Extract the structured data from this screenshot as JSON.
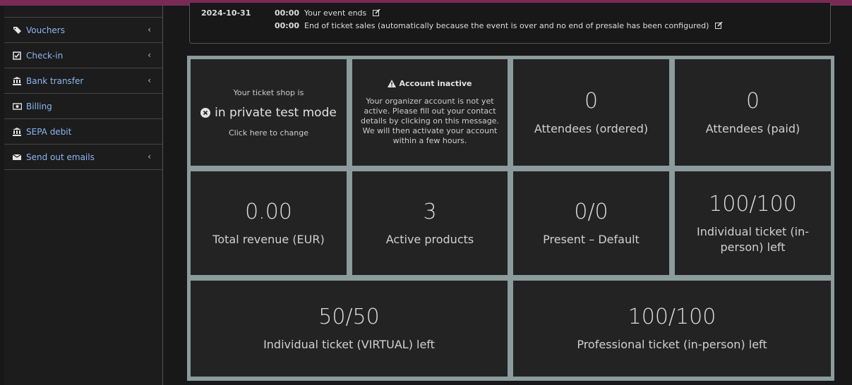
{
  "sidebar": {
    "items": [
      {
        "label": "Vouchers",
        "icon": "tags-icon",
        "chevron": "‹"
      },
      {
        "label": "Check-in",
        "icon": "check-square-icon",
        "chevron": "‹"
      },
      {
        "label": "Bank transfer",
        "icon": "bank-icon",
        "chevron": "‹"
      },
      {
        "label": "Billing",
        "icon": "money-icon"
      },
      {
        "label": "SEPA debit",
        "icon": "bank-icon"
      },
      {
        "label": "Send out emails",
        "icon": "envelope-icon",
        "chevron": "‹"
      }
    ],
    "link_color": "#8bb7f0"
  },
  "timeline": {
    "date": "2024-10-31",
    "rows": [
      {
        "time": "00:00",
        "text": "Your event ends"
      },
      {
        "time": "00:00",
        "text": "End of ticket sales (automatically because the event is over and no end of presale has been configured)"
      }
    ]
  },
  "shop_status": {
    "line1": "Your ticket shop is",
    "line2": "in private test mode",
    "line3": "Click here to change"
  },
  "account": {
    "title": "Account inactive",
    "body": "Your organizer account is not yet active. Please fill out your contact details by clicking on this message. We will then activate your account within a few hours."
  },
  "widgets": {
    "attendees_ordered": {
      "value": "0",
      "label": "Attendees (ordered)"
    },
    "attendees_paid": {
      "value": "0",
      "label": "Attendees (paid)"
    },
    "revenue": {
      "value": "0.00",
      "label": "Total revenue (EUR)"
    },
    "products": {
      "value": "3",
      "label": "Active products"
    },
    "present": {
      "value": "0/0",
      "label": "Present – Default"
    },
    "individual_inperson": {
      "value": "100/100",
      "label": "Individual ticket (in-person) left"
    },
    "individual_virtual": {
      "value": "50/50",
      "label": "Individual ticket (VIRTUAL) left"
    },
    "professional_inperson": {
      "value": "100/100",
      "label": "Professional ticket (in-person) left"
    }
  },
  "colors": {
    "brand_bar": "#7a2a57",
    "grid_border": "#8c9b9b",
    "tile_bg": "#232323"
  }
}
